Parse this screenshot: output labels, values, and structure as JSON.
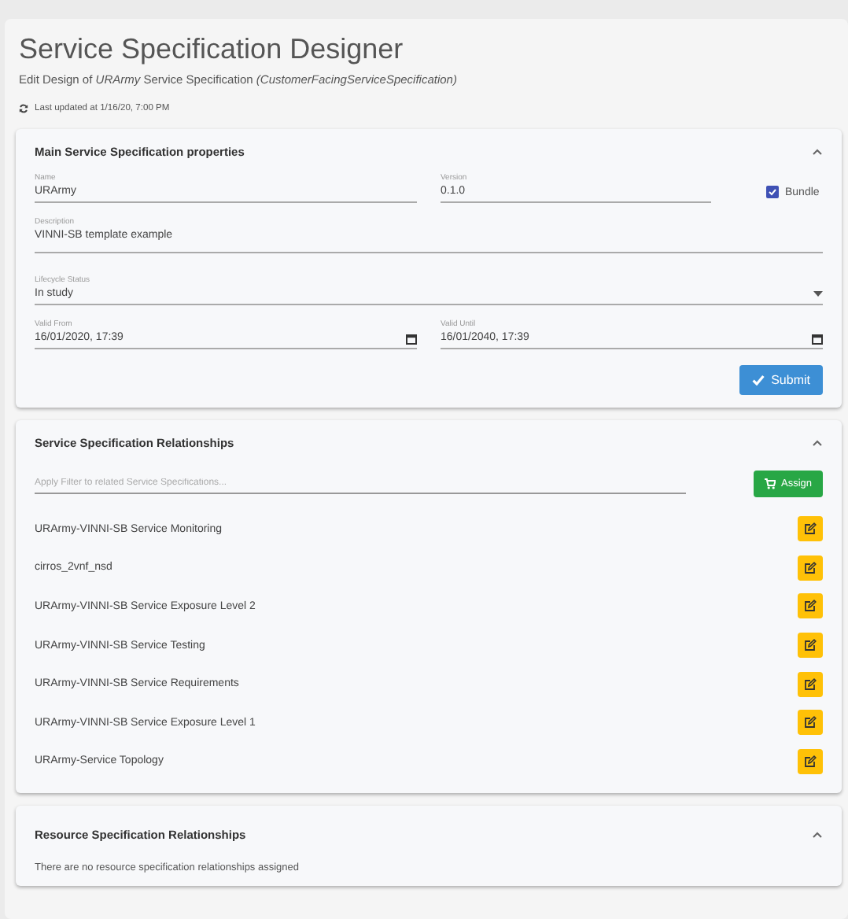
{
  "header": {
    "title": "Service Specification Designer",
    "subtitle": "Edit Design of *URArmy* Service Specification *(CustomerFacingServiceSpecification)*",
    "last_updated": "Last updated at 1/16/20, 7:00 PM"
  },
  "main_panel": {
    "title": "Main Service Specification properties",
    "expanded": true,
    "name": {
      "label": "Name",
      "value": "URArmy"
    },
    "version": {
      "label": "Version",
      "value": "0.1.0"
    },
    "bundle": {
      "label": "Bundle",
      "checked": true
    },
    "description": {
      "label": "Description",
      "value": "VINNI-SB template example"
    },
    "lifecycle_status": {
      "label": "Lifecycle Status",
      "value": "In study"
    },
    "valid_from": {
      "label": "Valid From",
      "value": "16/01/2020, 17:39"
    },
    "valid_until": {
      "label": "Valid Until",
      "value": "16/01/2040, 17:39"
    },
    "submit": "Submit"
  },
  "service_relationships": {
    "title": "Service Specification Relationships",
    "expanded": true,
    "filter": {
      "placeholder": "Apply Filter to related Service Specifications..."
    },
    "assign": "Assign",
    "items": [
      "URArmy-VINNI-SB Service Monitoring",
      "cirros_2vnf_nsd",
      "URArmy-VINNI-SB Service Exposure Level 2",
      "URArmy-VINNI-SB Service Testing",
      "URArmy-VINNI-SB Service Requirements",
      "URArmy-VINNI-SB Service Exposure Level 1",
      "URArmy-Service Topology"
    ]
  },
  "resource_relationships": {
    "title": "Resource Specification Relationships",
    "expanded": true,
    "empty_message": "There are no resource specification relationships assigned"
  }
}
